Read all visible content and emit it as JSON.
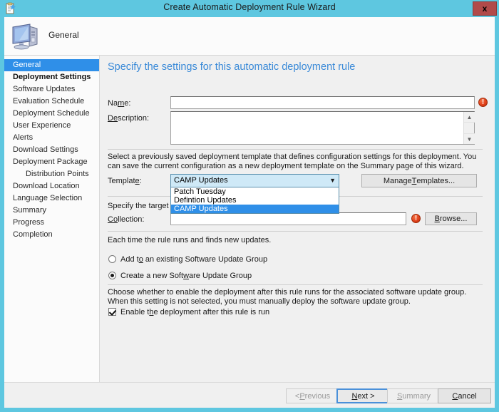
{
  "window": {
    "title": "Create Automatic Deployment Rule Wizard",
    "title_icon": "wizard-document-icon",
    "close_label": "x",
    "accent_color": "#5ec7e0",
    "close_color": "#b14a4a"
  },
  "header": {
    "icon": "computer-icon",
    "title": "General"
  },
  "sidebar": {
    "items": [
      {
        "label": "General",
        "state": "selected"
      },
      {
        "label": "Deployment Settings",
        "state": "bold"
      },
      {
        "label": "Software Updates",
        "state": "normal"
      },
      {
        "label": "Evaluation Schedule",
        "state": "normal"
      },
      {
        "label": "Deployment Schedule",
        "state": "normal"
      },
      {
        "label": "User Experience",
        "state": "normal"
      },
      {
        "label": "Alerts",
        "state": "normal"
      },
      {
        "label": "Download Settings",
        "state": "normal"
      },
      {
        "label": "Deployment Package",
        "state": "normal"
      },
      {
        "label": "Distribution Points",
        "state": "indent"
      },
      {
        "label": "Download Location",
        "state": "normal"
      },
      {
        "label": "Language Selection",
        "state": "normal"
      },
      {
        "label": "Summary",
        "state": "normal"
      },
      {
        "label": "Progress",
        "state": "normal"
      },
      {
        "label": "Completion",
        "state": "normal"
      }
    ]
  },
  "main": {
    "heading": "Specify the settings for this automatic deployment rule",
    "name_label_a": "Na",
    "name_label_b": "m",
    "name_label_c": "e:",
    "name_value": "",
    "description_label_a": "D",
    "description_label_b": "e",
    "description_label_c": "scription:",
    "description_value": "",
    "template_info": "Select a previously saved deployment template that defines configuration settings for this deployment. You can save the current configuration as a new deployment template on the Summary page of this wizard.",
    "template_label_a": "Templat",
    "template_label_b": "e",
    "template_label_c": ":",
    "template_selected": "CAMP Updates",
    "template_options": [
      {
        "label": "Patch Tuesday",
        "selected": false
      },
      {
        "label": "Defintion Updates",
        "selected": false
      },
      {
        "label": "CAMP Updates",
        "selected": true
      }
    ],
    "manage_templates_a": "Manage ",
    "manage_templates_b": "T",
    "manage_templates_c": "emplates...",
    "target_collection_text": "Specify the target collec",
    "collection_label_a": "C",
    "collection_label_b": "o",
    "collection_label_c": "llection:",
    "collection_value": "",
    "browse_a": "",
    "browse_b": "B",
    "browse_c": "rowse...",
    "rule_runs_text": "Each time the rule runs and finds new updates.",
    "radio_existing_a": "Add t",
    "radio_existing_b": "o",
    "radio_existing_c": " an existing Software Update Group",
    "radio_existing_selected": false,
    "radio_new_a": "Create a new Soft",
    "radio_new_b": "w",
    "radio_new_c": "are Update Group",
    "radio_new_selected": true,
    "enable_info": "Choose whether to enable the deployment after this rule runs for the associated software update group. When this setting is not selected, you must manually deploy the software update group.",
    "enable_checkbox_a": "Enable t",
    "enable_checkbox_b": "h",
    "enable_checkbox_c": "e deployment after this rule is run",
    "enable_checkbox_checked": true,
    "name_error": "!",
    "collection_error": "!"
  },
  "footer": {
    "previous_a": "< ",
    "previous_b": "P",
    "previous_c": "revious",
    "next_a": "",
    "next_b": "N",
    "next_c": "ext >",
    "summary_a": "",
    "summary_b": "S",
    "summary_c": "ummary",
    "cancel_a": "",
    "cancel_b": "C",
    "cancel_c": "ancel"
  }
}
